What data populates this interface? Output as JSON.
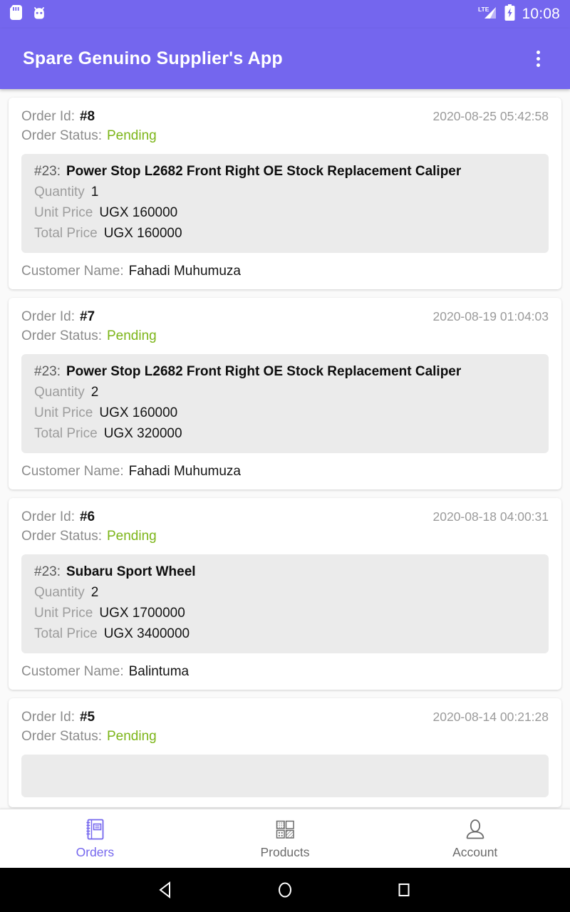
{
  "statusbar": {
    "icons": [
      "sd-card-icon",
      "android-bug-icon"
    ],
    "network": "LTE",
    "battery": "charging",
    "time": "10:08"
  },
  "appbar": {
    "title": "Spare Genuino Supplier's App",
    "overflow_menu": "overflow-menu-icon",
    "background_color": "#7466ee"
  },
  "labels": {
    "order_id": "Order Id:",
    "order_status": "Order Status:",
    "quantity": "Quantity",
    "unit_price": "Unit Price",
    "total_price": "Total Price",
    "customer_name": "Customer Name:"
  },
  "status_color": "#7cb518",
  "orders": [
    {
      "id": "#8",
      "date": "2020-08-25 05:42:58",
      "status": "Pending",
      "item": {
        "sku": "#23:",
        "name": "Power Stop L2682 Front Right OE Stock Replacement Caliper",
        "quantity": "1",
        "unit_price": "UGX 160000",
        "total_price": "UGX 160000"
      },
      "customer": "Fahadi Muhumuza"
    },
    {
      "id": "#7",
      "date": "2020-08-19 01:04:03",
      "status": "Pending",
      "item": {
        "sku": "#23:",
        "name": "Power Stop L2682 Front Right OE Stock Replacement Caliper",
        "quantity": "2",
        "unit_price": "UGX 160000",
        "total_price": "UGX 320000"
      },
      "customer": "Fahadi Muhumuza"
    },
    {
      "id": "#6",
      "date": "2020-08-18 04:00:31",
      "status": "Pending",
      "item": {
        "sku": "#23:",
        "name": "Subaru Sport Wheel",
        "quantity": "2",
        "unit_price": "UGX 1700000",
        "total_price": "UGX 3400000"
      },
      "customer": "Balintuma"
    },
    {
      "id": "#5",
      "date": "2020-08-14 00:21:28",
      "status": "Pending",
      "item": {
        "sku": "",
        "name": "",
        "quantity": "",
        "unit_price": "",
        "total_price": ""
      },
      "customer": ""
    }
  ],
  "bottomnav": {
    "active_color": "#7466ee",
    "inactive_color": "#6b6b6b",
    "items": [
      {
        "label": "Orders",
        "icon": "ledger-book-icon",
        "active": true
      },
      {
        "label": "Products",
        "icon": "grid-squares-icon",
        "active": false
      },
      {
        "label": "Account",
        "icon": "person-icon",
        "active": false
      }
    ]
  },
  "sysnav": {
    "back": "back-triangle-icon",
    "home": "home-circle-icon",
    "recents": "recents-square-icon"
  }
}
